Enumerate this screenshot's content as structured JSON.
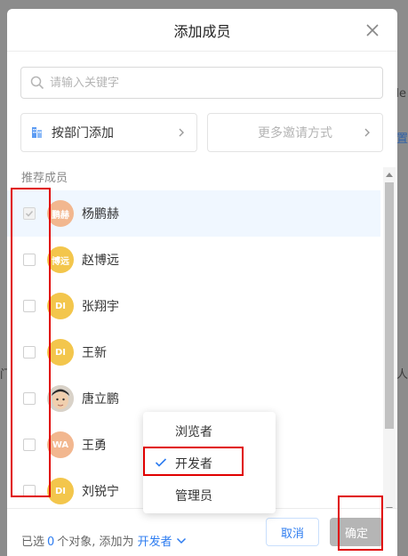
{
  "dialog": {
    "title": "添加成员"
  },
  "search": {
    "placeholder": "请输入关键字"
  },
  "add_options": {
    "by_department": "按部门添加",
    "more_invite": "更多邀请方式"
  },
  "section_label": "推荐成员",
  "members": [
    {
      "name": "杨鹏赫",
      "avatar_text": "鹏赫",
      "avatar_color": "#f2b78f",
      "checked": true
    },
    {
      "name": "赵博远",
      "avatar_text": "博远",
      "avatar_color": "#f3c64c",
      "checked": false
    },
    {
      "name": "张翔宇",
      "avatar_text": "DI",
      "avatar_color": "#f3c64c",
      "checked": false
    },
    {
      "name": "王新",
      "avatar_text": "DI",
      "avatar_color": "#f3c64c",
      "checked": false
    },
    {
      "name": "唐立鹏",
      "avatar_text": "",
      "avatar_color": "#e6e6e6",
      "checked": false
    },
    {
      "name": "王勇",
      "avatar_text": "WA",
      "avatar_color": "#f2b78f",
      "checked": false
    },
    {
      "name": "刘锐宁",
      "avatar_text": "DI",
      "avatar_color": "#f3c64c",
      "checked": false
    }
  ],
  "footer": {
    "selected_prefix": "已选",
    "selected_count": "0",
    "selected_suffix": "个对象, 添加为",
    "role": "开发者",
    "cancel": "取消",
    "confirm": "确定"
  },
  "role_menu": {
    "items": [
      "浏览者",
      "开发者",
      "管理员"
    ],
    "selected": "开发者"
  },
  "colors": {
    "accent": "#2d7cf0",
    "highlight_row": "#f0f7ff",
    "annotation": "#e00000"
  }
}
